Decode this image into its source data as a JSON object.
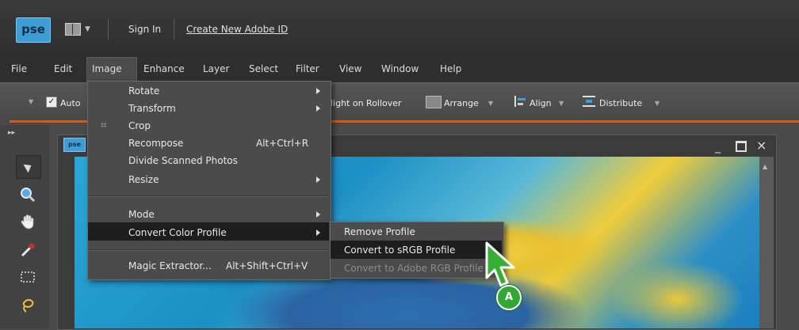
{
  "titlebar": {
    "logo": "pse",
    "sign_in": "Sign In",
    "create_id": "Create New Adobe ID"
  },
  "menubar": {
    "items": [
      "File",
      "Edit",
      "Image",
      "Enhance",
      "Layer",
      "Select",
      "Filter",
      "View",
      "Window",
      "Help"
    ],
    "active": "Image"
  },
  "toolbar": {
    "auto_label": "Auto",
    "auto_checked": true,
    "highlight_label": "hlight on Rollover",
    "arrange_label": "Arrange",
    "align_label": "Align",
    "distribute_label": "Distribute"
  },
  "document": {
    "tab_label": "pse",
    "window_min": "_",
    "window_close": "×"
  },
  "image_menu": {
    "items": [
      {
        "label": "Rotate",
        "submenu": true
      },
      {
        "label": "Transform",
        "submenu": true
      },
      {
        "label": "Crop",
        "icon": "crop-icon"
      },
      {
        "label": "Recompose",
        "shortcut": "Alt+Ctrl+R"
      },
      {
        "label": "Divide Scanned Photos"
      },
      {
        "label": "Resize",
        "submenu": true
      },
      {
        "label": "Mode",
        "submenu": true
      },
      {
        "label": "Convert Color Profile",
        "submenu": true,
        "highlighted": true
      },
      {
        "label": "Magic Extractor...",
        "shortcut": "Alt+Shift+Ctrl+V"
      }
    ]
  },
  "color_profile_submenu": {
    "items": [
      {
        "label": "Remove Profile",
        "enabled": true
      },
      {
        "label": "Convert to sRGB Profile",
        "enabled": true,
        "highlighted": true
      },
      {
        "label": "Convert to Adobe RGB Profile",
        "enabled": false
      }
    ]
  },
  "callout": {
    "label": "A"
  },
  "colors": {
    "accent_orange": "#d65a16",
    "logo_blue": "#3d9ed6",
    "callout_green": "#32a832"
  }
}
